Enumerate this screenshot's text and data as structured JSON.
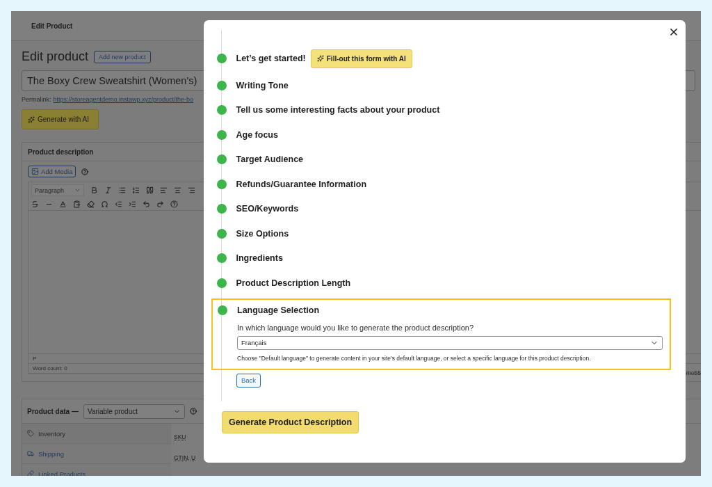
{
  "background": {
    "header_title": "Edit Product",
    "page_title": "Edit product",
    "add_new_button": "Add new product",
    "product_title": "The Boxy Crew Sweatshirt (Women's)",
    "permalink_label": "Permalink:",
    "permalink_url": "https://storeagentdemo.instawp.xyz/product/the-bo",
    "generate_button": "Generate with AI",
    "description_panel": {
      "title": "Product description",
      "add_media_button": "Add Media",
      "format_select": "Paragraph",
      "status_path": "P",
      "word_count": "Word count: 0"
    },
    "product_data": {
      "label": "Product data —",
      "type_select": "Variable product",
      "tabs": [
        {
          "label": "Inventory",
          "kind": "inventory",
          "selected": true
        },
        {
          "label": "Shipping",
          "kind": "shipping",
          "selected": false
        },
        {
          "label": "Linked Products",
          "kind": "linked",
          "selected": false
        }
      ],
      "fields": [
        "SKU",
        "GTIN, U"
      ]
    },
    "edge_text": "mo55"
  },
  "modal": {
    "steps": [
      {
        "kind": "intro",
        "label": "Let’s get started!",
        "action": "Fill-out this form with AI"
      },
      {
        "kind": "step",
        "label": "Writing Tone",
        "expanded": false
      },
      {
        "kind": "step",
        "label": "Tell us some interesting facts about your product",
        "expanded": false
      },
      {
        "kind": "step",
        "label": "Age focus",
        "expanded": false
      },
      {
        "kind": "step",
        "label": "Target Audience",
        "expanded": false
      },
      {
        "kind": "step",
        "label": "Refunds/Guarantee Information",
        "expanded": false
      },
      {
        "kind": "step",
        "label": "SEO/Keywords",
        "expanded": false
      },
      {
        "kind": "step",
        "label": "Size Options",
        "expanded": false
      },
      {
        "kind": "step",
        "label": "Ingredients",
        "expanded": false
      },
      {
        "kind": "step",
        "label": "Product Description Length",
        "expanded": false
      },
      {
        "kind": "select",
        "label": "Language Selection",
        "expanded": true,
        "question": "In which language would you like to generate the product description?",
        "value": "Français",
        "help": "Choose \"Default language\" to generate content in your site's default language, or select a specific language for this product description."
      }
    ],
    "back_button": "Back",
    "submit_button": "Generate Product Description"
  }
}
